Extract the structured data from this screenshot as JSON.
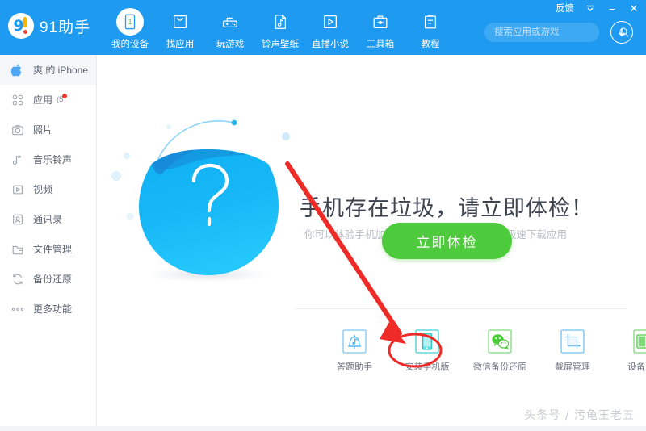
{
  "window": {
    "feedback_label": "反馈",
    "dropdown_icon": "chevron-down-icon",
    "minimize_label": "–",
    "close_label": "✕"
  },
  "brand": {
    "logo_icon": "91-logo-icon",
    "name": "91助手",
    "logo_nine": "9"
  },
  "nav": {
    "items": [
      {
        "label": "我的设备",
        "icon": "device-tablet-icon",
        "active": true
      },
      {
        "label": "找应用",
        "icon": "shopping-bag-icon",
        "active": false
      },
      {
        "label": "玩游戏",
        "icon": "gamepad-icon",
        "active": false
      },
      {
        "label": "铃声壁纸",
        "icon": "music-note-page-icon",
        "active": false
      },
      {
        "label": "直播小说",
        "icon": "play-square-icon",
        "active": false
      },
      {
        "label": "工具箱",
        "icon": "toolbox-icon",
        "active": false
      },
      {
        "label": "教程",
        "icon": "clipboard-icon",
        "active": false
      }
    ]
  },
  "search": {
    "placeholder": "搜索应用或游戏",
    "value": "",
    "icon": "search-icon"
  },
  "download": {
    "icon": "download-arrow-icon"
  },
  "sidebar": {
    "items": [
      {
        "label": "爽 的 iPhone",
        "icon": "apple-icon",
        "active": true,
        "badge": ""
      },
      {
        "label": "应用",
        "icon": "apps-grid-icon",
        "active": false,
        "badge": "(5"
      },
      {
        "label": "照片",
        "icon": "camera-icon",
        "active": false,
        "badge": ""
      },
      {
        "label": "音乐铃声",
        "icon": "music-note-icon",
        "active": false,
        "badge": ""
      },
      {
        "label": "视频",
        "icon": "video-play-icon",
        "active": false,
        "badge": ""
      },
      {
        "label": "通讯录",
        "icon": "contacts-icon",
        "active": false,
        "badge": ""
      },
      {
        "label": "文件管理",
        "icon": "folder-icon",
        "active": false,
        "badge": ""
      },
      {
        "label": "备份还原",
        "icon": "refresh-sync-icon",
        "active": false,
        "badge": ""
      },
      {
        "label": "更多功能",
        "icon": "ellipsis-icon",
        "active": false,
        "badge": ""
      }
    ]
  },
  "main": {
    "illustration_icon": "blue-circle-question-icon",
    "question_mark": "?",
    "headline": "手机存在垃圾，请立即体检！",
    "subline": "你可以体验手机加速，垃圾清理，照片清理，极速下载应用",
    "cta_label": "立即体检",
    "tools": [
      {
        "label": "答题助手",
        "icon": "bell-music-icon",
        "color": "#4db8f0"
      },
      {
        "label": "安装手机版",
        "icon": "phone-install-icon",
        "color": "#2ec7c9"
      },
      {
        "label": "微信备份还原",
        "icon": "wechat-icon",
        "color": "#4ecb3c"
      },
      {
        "label": "截屏管理",
        "icon": "crop-screenshot-icon",
        "color": "#4db8f0"
      },
      {
        "label": "设备信息",
        "icon": "device-info-icon",
        "color": "#4ecb3c"
      }
    ]
  },
  "annotation": {
    "arrow_icon": "red-arrow-icon",
    "highlight_icon": "red-ellipse-highlight-icon",
    "arrow_color": "#ee2b26",
    "target_tool": "安装手机版"
  },
  "watermark": {
    "text": "头条号 / 污龟王老五"
  },
  "colors": {
    "brand_blue": "#1e9bf0",
    "cta_green": "#4ecb3c",
    "annotation_red": "#ee2b26",
    "sidebar_text": "#5a6270"
  }
}
